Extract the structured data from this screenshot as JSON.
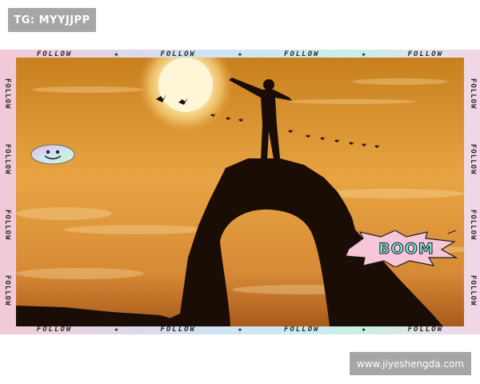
{
  "watermark_top": "TG: MYYJJPP",
  "watermark_bottom": "www.jiyeshengda.com",
  "frame": {
    "top_labels": [
      "FOLLOW",
      "FOLLOW",
      "FOLLOW",
      "FOLLOW"
    ],
    "bottom_labels": [
      "FOLLOW",
      "FOLLOW",
      "FOLLOW",
      "FOLLOW"
    ],
    "left_labels": [
      "FOLLOW",
      "FOLLOW",
      "FOLLOW",
      "FOLLOW"
    ],
    "right_labels": [
      "FOLLOW",
      "FOLLOW",
      "FOLLOW",
      "FOLLOW"
    ],
    "separator": "✦"
  },
  "sticker_boom": "BOOM",
  "colors": {
    "sky_top": "#c8801e",
    "sky_mid": "#e8a443",
    "sky_horizon": "#c9772a",
    "sun": "#fff6d8",
    "silhouette": "#1a0d06",
    "boom_fill": "#7fe0d6"
  },
  "icons": [
    "smiley-sticker-icon",
    "boom-burst-icon",
    "bird-icon"
  ]
}
